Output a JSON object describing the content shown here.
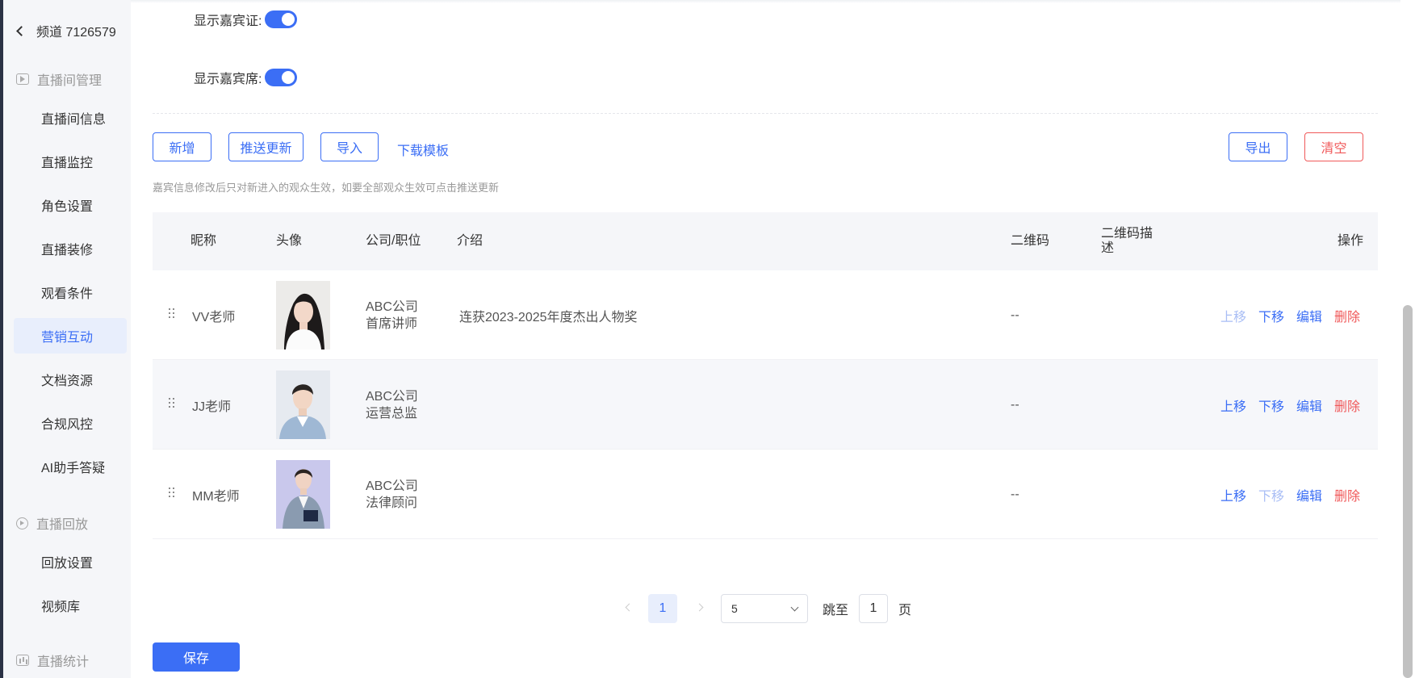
{
  "sidebar": {
    "back_label": "频道 7126579",
    "groups": {
      "live_mgmt": "直播间管理",
      "replay": "直播回放",
      "stats": "直播统计"
    },
    "items": [
      {
        "label": "直播间信息"
      },
      {
        "label": "直播监控"
      },
      {
        "label": "角色设置"
      },
      {
        "label": "直播装修"
      },
      {
        "label": "观看条件"
      },
      {
        "label": "营销互动",
        "active": true
      },
      {
        "label": "文档资源"
      },
      {
        "label": "合规风控"
      },
      {
        "label": "AI助手答疑"
      }
    ],
    "replay_items": [
      {
        "label": "回放设置"
      },
      {
        "label": "视频库"
      }
    ]
  },
  "settings": {
    "show_badge_label": "显示嘉宾证:",
    "show_badge_on": true,
    "show_seat_label": "显示嘉宾席:",
    "show_seat_on": true
  },
  "toolbar": {
    "add": "新增",
    "push_update": "推送更新",
    "import": "导入",
    "download_template": "下载模板",
    "export": "导出",
    "clear": "清空"
  },
  "hint": "嘉宾信息修改后只对新进入的观众生效，如要全部观众生效可点击推送更新",
  "table": {
    "headers": {
      "nickname": "昵称",
      "avatar": "头像",
      "company_position": "公司/职位",
      "intro": "介绍",
      "qrcode": "二维码",
      "qrcode_desc_1": "二维码描",
      "qrcode_desc_2": "述",
      "actions": "操作"
    },
    "actions": {
      "up": "上移",
      "down": "下移",
      "edit": "编辑",
      "delete": "删除"
    },
    "rows": [
      {
        "nickname": "VV老师",
        "company": "ABC公司",
        "position": "首席讲师",
        "intro": "连获2023-2025年度杰出人物奖",
        "qrcode": "--",
        "up_disabled": true,
        "down_disabled": false
      },
      {
        "nickname": "JJ老师",
        "company": "ABC公司",
        "position": "运营总监",
        "intro": "",
        "qrcode": "--",
        "up_disabled": false,
        "down_disabled": false
      },
      {
        "nickname": "MM老师",
        "company": "ABC公司",
        "position": "法律顾问",
        "intro": "",
        "qrcode": "--",
        "up_disabled": false,
        "down_disabled": true
      }
    ]
  },
  "pagination": {
    "current_page": "1",
    "page_size": "5",
    "jump_label": "跳至",
    "jump_value": "1",
    "page_suffix": "页"
  },
  "save_label": "保存",
  "colors": {
    "primary": "#3b6ef5",
    "danger": "#f0595a",
    "disabled": "#a9bef5",
    "sidebar_bg": "#f5f6f9"
  }
}
